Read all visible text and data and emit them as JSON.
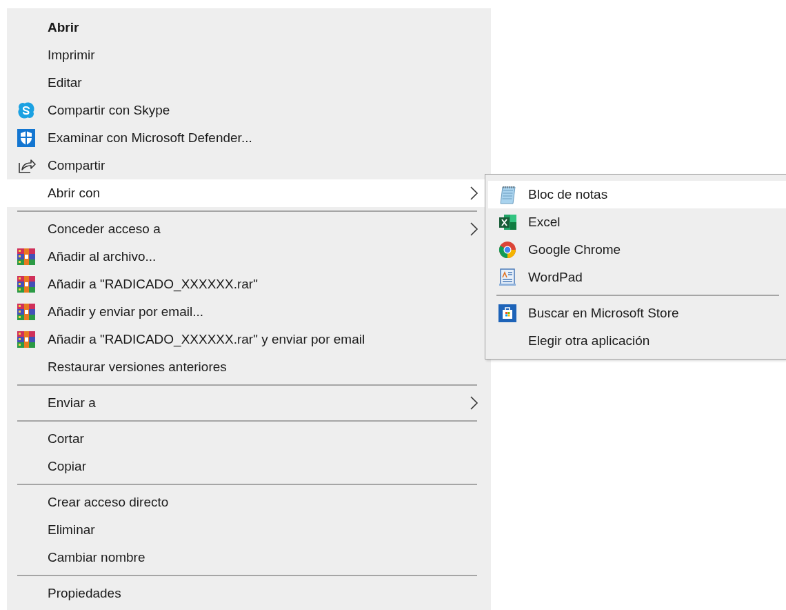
{
  "context_menu": {
    "groups": [
      {
        "items": [
          {
            "label": "Abrir",
            "bold": true,
            "selected": false,
            "submenu": false
          },
          {
            "label": "Imprimir",
            "bold": false,
            "selected": false,
            "submenu": false
          },
          {
            "label": "Editar",
            "bold": false,
            "selected": false,
            "submenu": false
          },
          {
            "label": "Compartir con Skype",
            "kind": "skype",
            "bold": false,
            "selected": false,
            "submenu": false
          },
          {
            "label": "Examinar con Microsoft Defender...",
            "kind": "shield",
            "bold": false,
            "selected": false,
            "submenu": false
          },
          {
            "label": "Compartir",
            "kind": "share",
            "bold": false,
            "selected": false,
            "submenu": false
          },
          {
            "label": "Abrir con",
            "bold": false,
            "selected": true,
            "submenu": true
          }
        ]
      },
      {
        "items": [
          {
            "label": "Conceder acceso a",
            "bold": false,
            "selected": false,
            "submenu": true
          },
          {
            "label": "Añadir al archivo...",
            "kind": "archive",
            "bold": false,
            "selected": false,
            "submenu": false
          },
          {
            "label": "Añadir a \"RADICADO_XXXXXX.rar\"",
            "kind": "archive",
            "bold": false,
            "selected": false,
            "submenu": false
          },
          {
            "label": "Añadir y enviar por email...",
            "kind": "archive",
            "bold": false,
            "selected": false,
            "submenu": false
          },
          {
            "label": "Añadir a \"RADICADO_XXXXXX.rar\" y enviar por email",
            "kind": "archive",
            "bold": false,
            "selected": false,
            "submenu": false
          },
          {
            "label": "Restaurar versiones anteriores",
            "bold": false,
            "selected": false,
            "submenu": false
          }
        ]
      },
      {
        "items": [
          {
            "label": "Enviar a",
            "bold": false,
            "selected": false,
            "submenu": true
          }
        ]
      },
      {
        "items": [
          {
            "label": "Cortar",
            "bold": false,
            "selected": false,
            "submenu": false
          },
          {
            "label": "Copiar",
            "bold": false,
            "selected": false,
            "submenu": false
          }
        ]
      },
      {
        "items": [
          {
            "label": "Crear acceso directo",
            "bold": false,
            "selected": false,
            "submenu": false
          },
          {
            "label": "Eliminar",
            "bold": false,
            "selected": false,
            "submenu": false
          },
          {
            "label": "Cambiar nombre",
            "bold": false,
            "selected": false,
            "submenu": false
          }
        ]
      },
      {
        "items": [
          {
            "label": "Propiedades",
            "bold": false,
            "selected": false,
            "submenu": false
          }
        ]
      }
    ]
  },
  "open_with_menu": {
    "groups": [
      {
        "items": [
          {
            "label": "Bloc de notas",
            "kind": "notepad",
            "selected": true
          },
          {
            "label": "Excel",
            "kind": "spreadsheet",
            "selected": false
          },
          {
            "label": "Google Chrome",
            "kind": "browser",
            "selected": false
          },
          {
            "label": "WordPad",
            "kind": "document",
            "selected": false
          }
        ]
      },
      {
        "items": [
          {
            "label": "Buscar en Microsoft Store",
            "kind": "store",
            "selected": false
          },
          {
            "label": "Elegir otra aplicación",
            "selected": false
          }
        ]
      }
    ]
  }
}
